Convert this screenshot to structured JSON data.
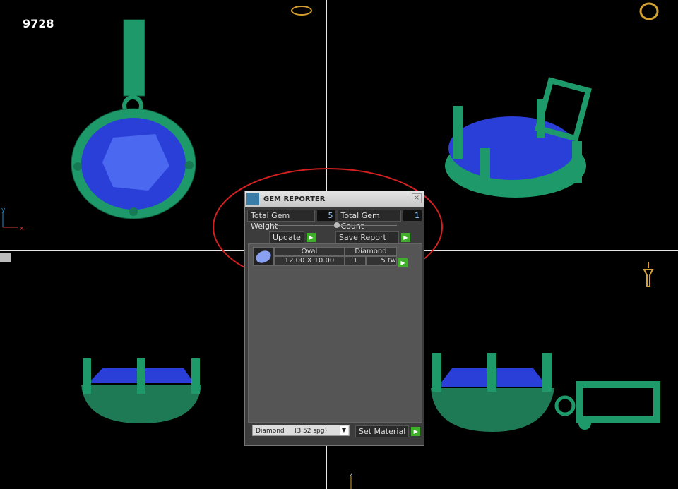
{
  "viewport": {
    "model_id": "9728",
    "axis_labels": {
      "y": "y",
      "x": "x",
      "z": "z"
    }
  },
  "colors": {
    "metal": "#1e9a6a",
    "gem": "#2a3fd8",
    "annotation": "#d42020",
    "button": "#3fae2a"
  },
  "panel": {
    "title": "GEM REPORTER",
    "close_icon": "×",
    "total_gem_weight_label": "Total Gem Weight",
    "total_gem_weight": "5",
    "total_gem_count_label": "Total Gem Count",
    "total_gem_count": "1",
    "update_label": "Update",
    "save_report_label": "Save Report",
    "play_icon": "▶",
    "gems": [
      {
        "shape": "Oval",
        "material": "Diamond",
        "size": "12.00 X 10.00",
        "count": "1",
        "weight": "5",
        "unit": "tw"
      }
    ],
    "material_select": "Diamond     (3.52 spg)",
    "set_material_label": "Set Material"
  }
}
